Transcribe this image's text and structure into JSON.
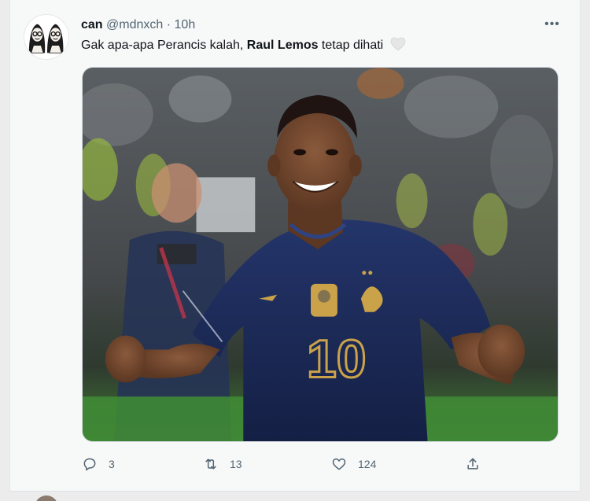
{
  "tweet": {
    "display_name": "can",
    "handle": "@mdnxch",
    "separator": "·",
    "time": "10h",
    "text_before": "Gak apa-apa Perancis kalah, ",
    "text_bold": "Raul Lemos",
    "text_after": " tetap dihati",
    "more_label": "•••"
  },
  "media": {
    "jersey_number": "10"
  },
  "actions": {
    "replies": "3",
    "retweets": "13",
    "likes": "124"
  },
  "colors": {
    "muted": "#536471",
    "text": "#0f1419",
    "card": "#f7f9f9",
    "jersey": "#1b2a57",
    "gold": "#c9a24a"
  }
}
